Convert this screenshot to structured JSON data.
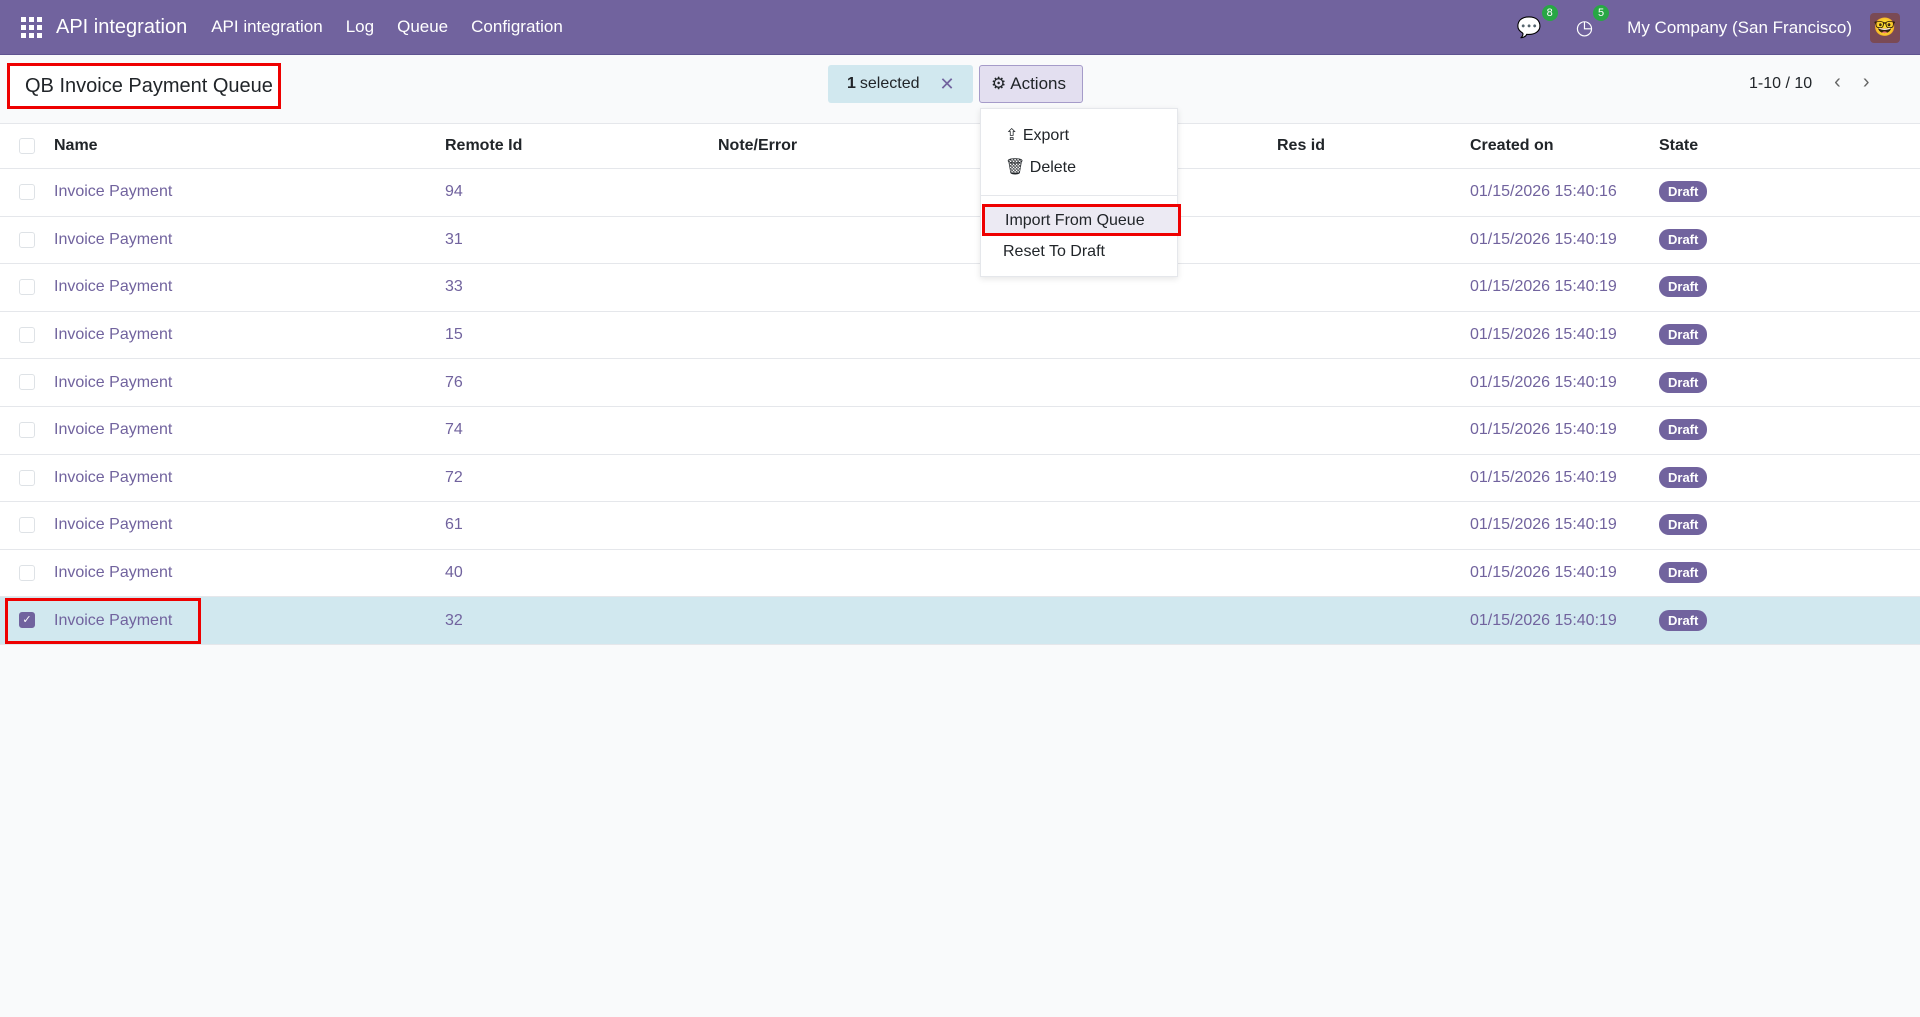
{
  "nav": {
    "brand": "API integration",
    "menu": [
      "API integration",
      "Log",
      "Queue",
      "Configration"
    ],
    "messages_count": "8",
    "activity_count": "5",
    "company": "My Company (San Francisco)"
  },
  "page_title": "QB Invoice Payment Queue",
  "selection": {
    "count_label": "1",
    "label": "selected"
  },
  "actions": {
    "label": "Actions",
    "items": [
      "Export",
      "Delete",
      "Import From Queue",
      "Reset To Draft"
    ]
  },
  "pager": {
    "range": "1-10 / 10"
  },
  "table": {
    "headers": [
      "Name",
      "Remote Id",
      "Note/Error",
      "Res id",
      "Created on",
      "State"
    ],
    "rows": [
      {
        "name": "Invoice Payment",
        "remote_id": "94",
        "created": "01/15/2026 15:40:16",
        "state": "Draft"
      },
      {
        "name": "Invoice Payment",
        "remote_id": "31",
        "created": "01/15/2026 15:40:19",
        "state": "Draft"
      },
      {
        "name": "Invoice Payment",
        "remote_id": "33",
        "created": "01/15/2026 15:40:19",
        "state": "Draft"
      },
      {
        "name": "Invoice Payment",
        "remote_id": "15",
        "created": "01/15/2026 15:40:19",
        "state": "Draft"
      },
      {
        "name": "Invoice Payment",
        "remote_id": "76",
        "created": "01/15/2026 15:40:19",
        "state": "Draft"
      },
      {
        "name": "Invoice Payment",
        "remote_id": "74",
        "created": "01/15/2026 15:40:19",
        "state": "Draft"
      },
      {
        "name": "Invoice Payment",
        "remote_id": "72",
        "created": "01/15/2026 15:40:19",
        "state": "Draft"
      },
      {
        "name": "Invoice Payment",
        "remote_id": "61",
        "created": "01/15/2026 15:40:19",
        "state": "Draft"
      },
      {
        "name": "Invoice Payment",
        "remote_id": "40",
        "created": "01/15/2026 15:40:19",
        "state": "Draft"
      },
      {
        "name": "Invoice Payment",
        "remote_id": "32",
        "created": "01/15/2026 15:40:19",
        "state": "Draft",
        "selected": true
      }
    ]
  }
}
